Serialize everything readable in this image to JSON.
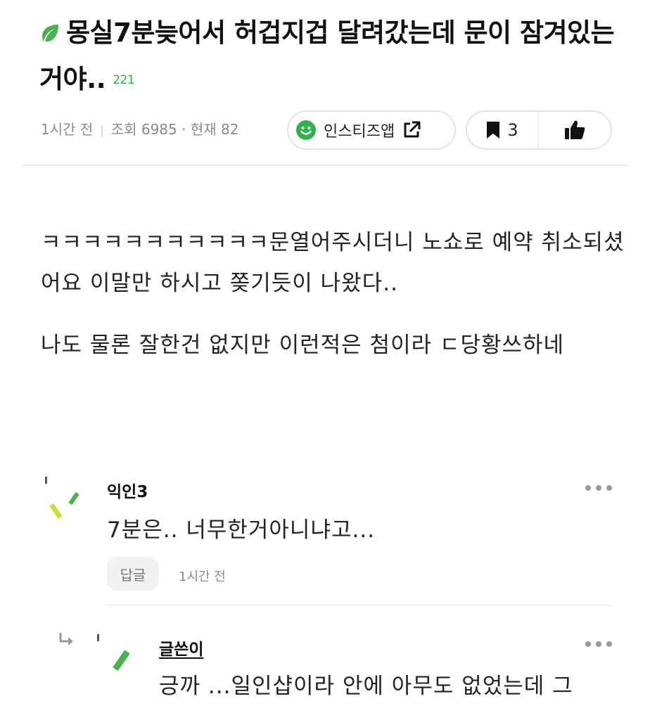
{
  "post": {
    "title": "몽실7분늦어서 허겁지겁 달려갔는데 문이 잠겨있는거야..",
    "comment_count": "221",
    "time": "1시간 전",
    "views": "조회 6985 · 현재 82",
    "app_button": "인스티즈앱",
    "bookmark_count": "3",
    "paragraphs": [
      "ㅋㅋㅋㅋㅋㅋㅋㅋㅋㅋㅋ문열어주시더니 노쇼로 예약 취소되셨어요 이말만 하시고 쫒기듯이 나왔다..",
      "나도 물론 잘한건 없지만 이런적은 첨이라 ㄷ당황쓰하네"
    ]
  },
  "comments": [
    {
      "author": "익인3",
      "text": "7분은.. 너무한거아니냐고...",
      "reply_label": "답글",
      "time": "1시간 전"
    },
    {
      "author": "글쓴이",
      "text": "긍까 ...일인샵이라 안에 아무도 없었는데 그"
    }
  ],
  "colors": {
    "accent_green": "#2fb14f",
    "leaf_green": "#4caf50",
    "avatar_lime": "#cddc39",
    "text": "#222222",
    "muted": "#8a8a8a"
  },
  "icons": [
    "leaf-icon",
    "smile-icon",
    "external-link-icon",
    "bookmark-icon",
    "thumbs-up-icon",
    "more-icon",
    "reply-arrow-icon"
  ]
}
